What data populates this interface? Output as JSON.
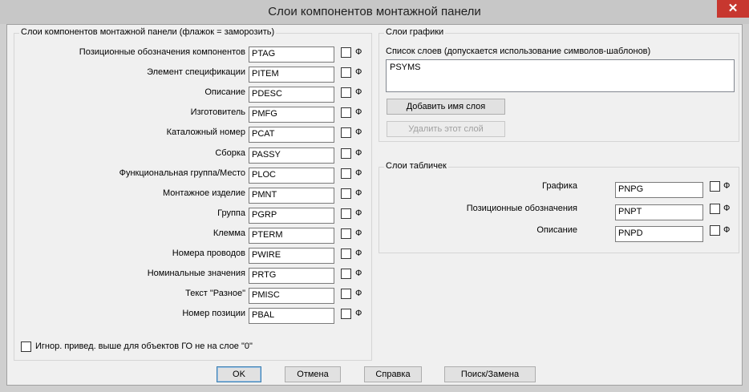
{
  "window": {
    "title": "Слои компонентов монтажной панели",
    "close_glyph": "✕"
  },
  "left_group": {
    "legend": "Слои компонентов монтажной панели (флажок = заморозить)",
    "freeze_label": "Ф",
    "rows": [
      {
        "label": "Позиционные обозначения компонентов",
        "value": "PTAG"
      },
      {
        "label": "Элемент спецификации",
        "value": "PITEM"
      },
      {
        "label": "Описание",
        "value": "PDESC"
      },
      {
        "label": "Изготовитель",
        "value": "PMFG"
      },
      {
        "label": "Каталожный номер",
        "value": "PCAT"
      },
      {
        "label": "Сборка",
        "value": "PASSY"
      },
      {
        "label": "Функциональная группа/Место",
        "value": "PLOC"
      },
      {
        "label": "Монтажное изделие",
        "value": "PMNT"
      },
      {
        "label": "Группа",
        "value": "PGRP"
      },
      {
        "label": "Клемма",
        "value": "PTERM"
      },
      {
        "label": "Номера проводов",
        "value": "PWIRE"
      },
      {
        "label": "Номинальные значения",
        "value": "PRTG"
      },
      {
        "label": "Текст \"Разное\"",
        "value": "PMISC"
      },
      {
        "label": "Номер позиции",
        "value": "PBAL"
      }
    ],
    "ignore_checkbox_label": "Игнор. привед. выше для объектов ГО не на слое \"0\""
  },
  "graphics_group": {
    "legend": "Слои графики",
    "list_label": "Список слоев (допускается использование символов-шаблонов)",
    "list_items": [
      "PSYMS"
    ],
    "add_button": "Добавить имя слоя",
    "delete_button": "Удалить этот слой"
  },
  "nameplate_group": {
    "legend": "Слои табличек",
    "freeze_label": "Ф",
    "rows": [
      {
        "label": "Графика",
        "value": "PNPG"
      },
      {
        "label": "Позиционные обозначения",
        "value": "PNPT"
      },
      {
        "label": "Описание",
        "value": "PNPD"
      }
    ]
  },
  "buttons": {
    "ok": "OK",
    "cancel": "Отмена",
    "help": "Справка",
    "search": "Поиск/Замена"
  }
}
